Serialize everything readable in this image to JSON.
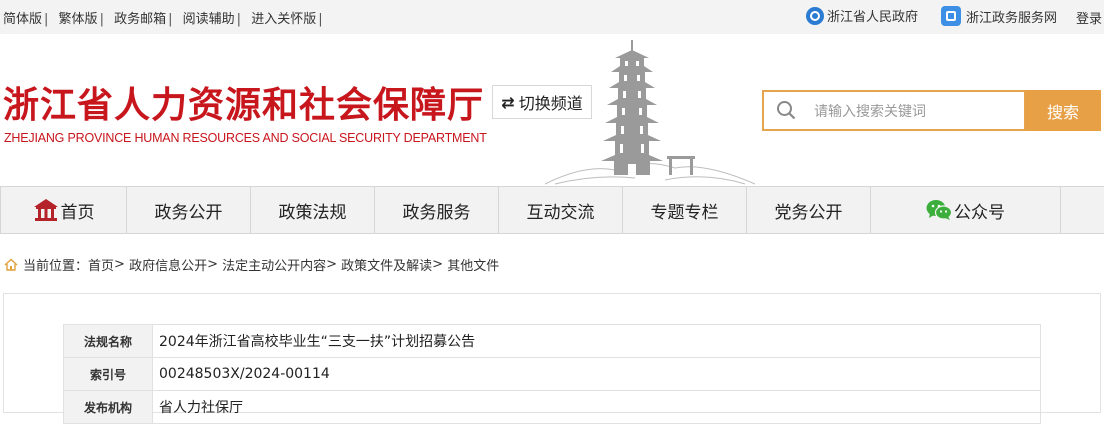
{
  "topbar": {
    "links": [
      "简体版",
      "繁体版",
      "政务邮箱",
      "阅读辅助",
      "进入关怀版"
    ],
    "gov_label": "浙江省人民政府",
    "service_label": "浙江政务服务网",
    "login_label": "登录"
  },
  "header": {
    "title_cn": "浙江省人力资源和社会保障厅",
    "title_en": "ZHEJIANG PROVINCE HUMAN RESOURCES AND SOCIAL SECURITY DEPARTMENT",
    "switch_label": "切换频道",
    "search_placeholder": "请输入搜索关键词",
    "search_button": "搜索"
  },
  "nav": {
    "items": [
      "首页",
      "政务公开",
      "政策法规",
      "政务服务",
      "互动交流",
      "专题专栏",
      "党务公开",
      "公众号"
    ]
  },
  "breadcrumb": {
    "label": "当前位置：",
    "items": [
      "首页",
      "政府信息公开",
      "法定主动公开内容",
      "政策文件及解读",
      "其他文件"
    ]
  },
  "meta_table": {
    "rows": [
      {
        "key": "法规名称",
        "value": "2024年浙江省高校毕业生“三支一扶”计划招募公告"
      },
      {
        "key": "索引号",
        "value": "00248503X/2024-00114"
      },
      {
        "key": "发布机构",
        "value": "省人力社保厅"
      }
    ]
  },
  "colors": {
    "brand_red": "#c8161d",
    "accent_orange": "#e8a047"
  }
}
